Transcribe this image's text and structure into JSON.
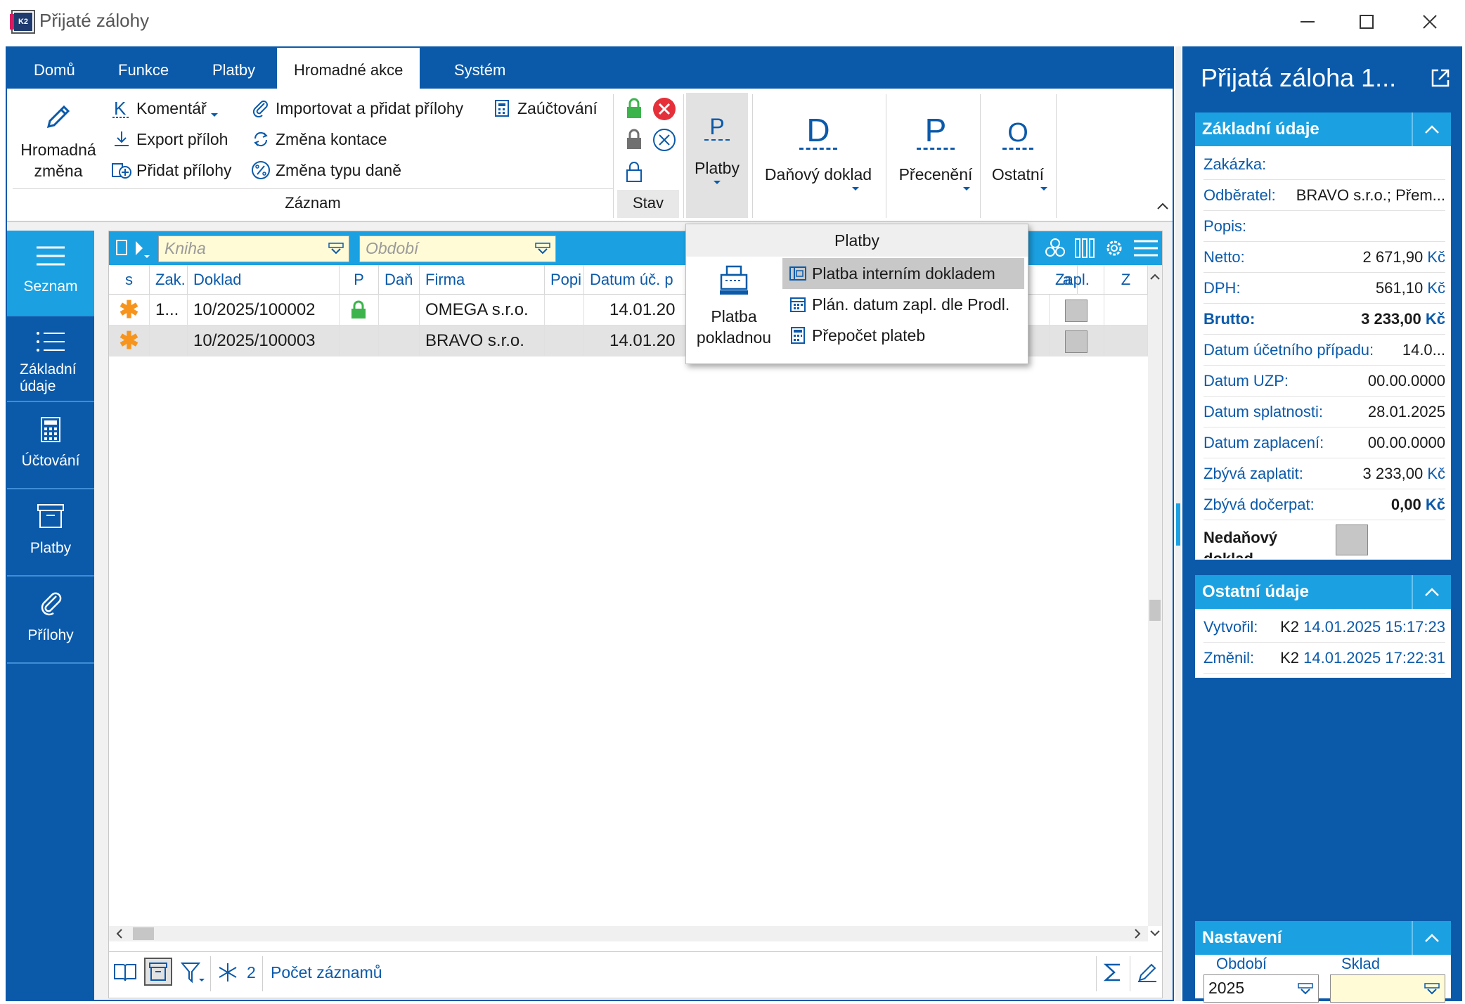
{
  "window": {
    "title": "Přijaté zálohy"
  },
  "ribbon": {
    "tabs": [
      {
        "label": "Domů"
      },
      {
        "label": "Funkce"
      },
      {
        "label": "Platby"
      },
      {
        "label": "Hromadné akce"
      },
      {
        "label": "Systém"
      }
    ],
    "hromadna_zmena": "Hromadná změna",
    "items": {
      "komentar": "Komentář",
      "export_priloh": "Export příloh",
      "pridat_prilohy": "Přidat přílohy",
      "importovat": "Importovat a přidat přílohy",
      "zmena_kontace": "Změna kontace",
      "zmena_typu_dane": "Změna typu daně",
      "zauctovani": "Zaúčtování"
    },
    "group_zaznam": "Záznam",
    "group_stav": "Stav",
    "big": {
      "platby": {
        "letter": "P",
        "label": "Platby"
      },
      "danovy": {
        "letter": "D",
        "label": "Daňový doklad"
      },
      "preceneni": {
        "letter": "P",
        "label": "Přecenění"
      },
      "ostatni": {
        "letter": "O",
        "label": "Ostatní"
      }
    }
  },
  "leftnav": [
    {
      "label": "Seznam",
      "icon": "list-icon"
    },
    {
      "label": "Základní údaje",
      "icon": "details-icon"
    },
    {
      "label": "Účtování",
      "icon": "calculator-icon"
    },
    {
      "label": "Platby",
      "icon": "box-icon"
    },
    {
      "label": "Přílohy",
      "icon": "paperclip-icon"
    }
  ],
  "filter": {
    "kniha_placeholder": "Kniha",
    "obdobi_placeholder": "Období"
  },
  "table": {
    "columns": [
      "s",
      "Zak.",
      "Doklad",
      "P",
      "Daň",
      "Firma",
      "Popi",
      "Datum úč. p",
      "a",
      "Zapl.",
      "Z"
    ],
    "rows": [
      {
        "zak": "1...",
        "doklad": "10/2025/100002",
        "firma": "OMEGA s.r.o.",
        "datum": "14.01.20",
        "locked": true
      },
      {
        "zak": "",
        "doklad": "10/2025/100003",
        "firma": "BRAVO s.r.o.",
        "datum": "14.01.20",
        "locked": false
      }
    ]
  },
  "status": {
    "count": "2",
    "pocet_label": "Počet záznamů"
  },
  "popup": {
    "title": "Platby",
    "big_label": "Platba pokladnou",
    "items": [
      "Platba interním dokladem",
      "Plán. datum zapl. dle Prodl.",
      "Přepočet plateb"
    ]
  },
  "right": {
    "title": "Přijatá záloha 1...",
    "zakladni": {
      "header": "Základní údaje",
      "zakazka": "Zakázka:",
      "odberatel_label": "Odběratel:",
      "odberatel_value": "BRAVO s.r.o.; Přem...",
      "popis": "Popis:",
      "netto_label": "Netto:",
      "netto_value": "2 671,90",
      "netto_cur": "Kč",
      "dph_label": "DPH:",
      "dph_value": "561,10",
      "dph_cur": "Kč",
      "brutto_label": "Brutto:",
      "brutto_value": "3 233,00",
      "brutto_cur": "Kč",
      "datum_uc_label": "Datum účetního případu:",
      "datum_uc_value": "14.0...",
      "uzp_label": "Datum UZP:",
      "uzp_value": "00.00.0000",
      "splat_label": "Datum splatnosti:",
      "splat_value": "28.01.2025",
      "zapl_label": "Datum zaplacení:",
      "zapl_value": "00.00.0000",
      "zbyva_label": "Zbývá zaplatit:",
      "zbyva_value": "3 233,00",
      "zbyva_cur": "Kč",
      "docerpat_label": "Zbývá dočerpat:",
      "docerpat_value": "0,00",
      "docerpat_cur": "Kč",
      "nedan_label": "Nedaňový doklad"
    },
    "ostatni": {
      "header": "Ostatní údaje",
      "vytvoril_label": "Vytvořil:",
      "vytvoril_user": "K2",
      "vytvoril_time": "14.01.2025 15:17:23",
      "zmenil_label": "Změnil:",
      "zmenil_user": "K2",
      "zmenil_time": "14.01.2025 17:22:31"
    },
    "nastaveni": {
      "header": "Nastavení",
      "obdobi_label": "Období",
      "obdobi_value": "2025",
      "sklad_label": "Sklad",
      "sklad_value": ""
    }
  },
  "colors": {
    "blue": "#0b5aaa",
    "cyan": "#1ba1e2",
    "orange": "#f7941d",
    "green": "#3cb44b",
    "red": "#e5303a"
  }
}
